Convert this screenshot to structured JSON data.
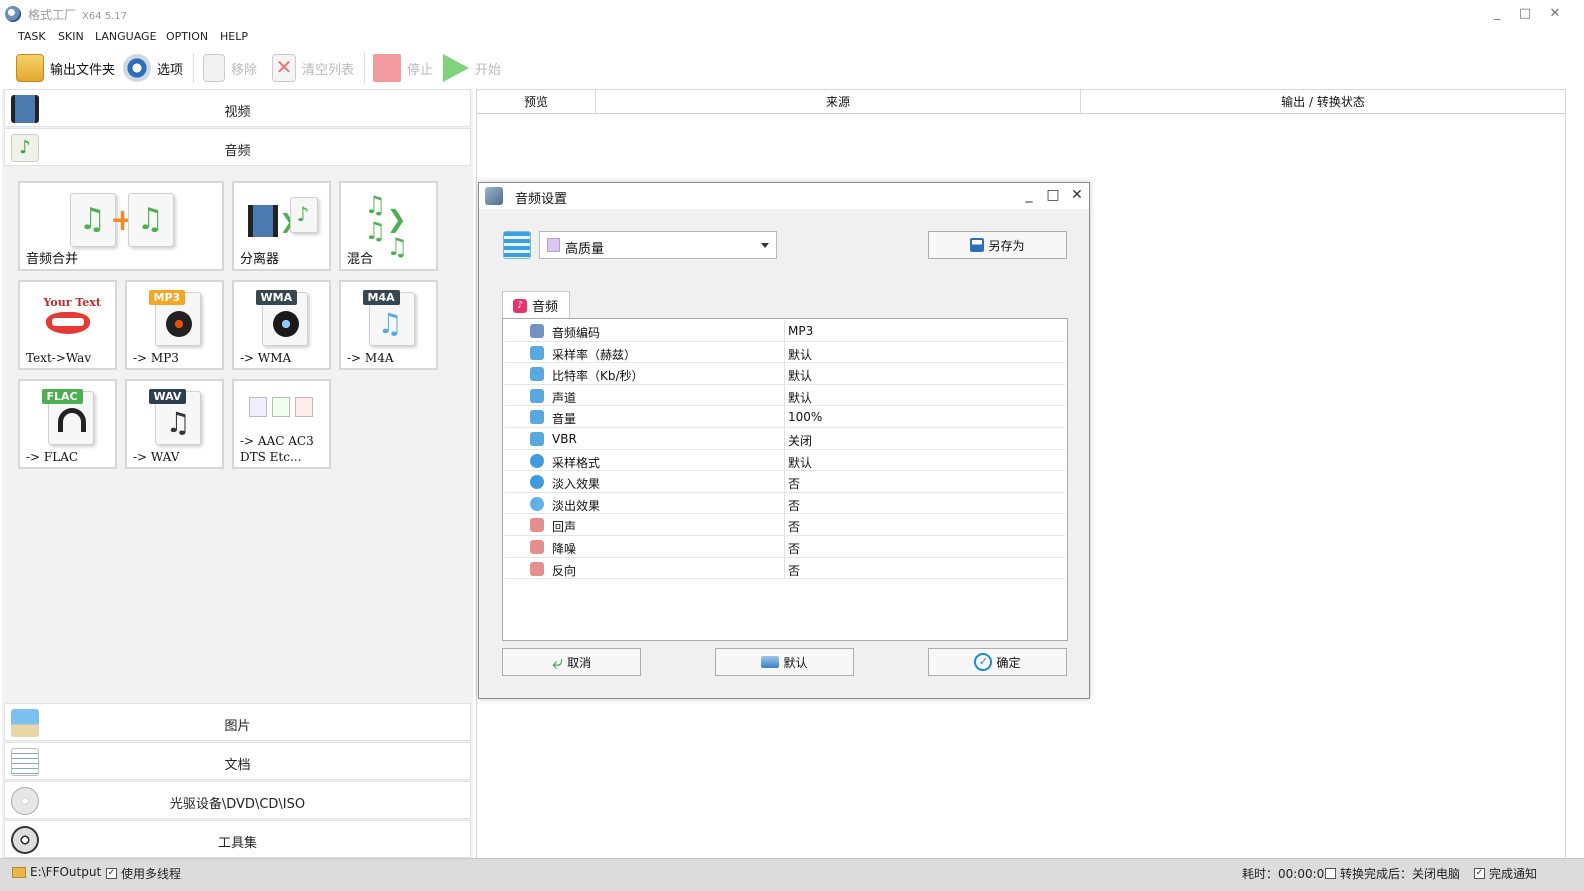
{
  "window": {
    "title": "格式工厂",
    "version": "X64 5.17"
  },
  "menu": [
    "TASK",
    "SKIN",
    "LANGUAGE",
    "OPTION",
    "HELP"
  ],
  "toolbar": {
    "output_folder": "输出文件夹",
    "options": "选项",
    "remove": "移除",
    "clear_list": "清空列表",
    "stop": "停止",
    "start": "开始"
  },
  "categories": {
    "video": "视频",
    "audio": "音频",
    "picture": "图片",
    "document": "文档",
    "rom": "光驱设备\\DVD\\CD\\ISO",
    "toolbox": "工具集"
  },
  "audio_tools": {
    "merge": "音频合并",
    "splitter": "分离器",
    "mix": "混合",
    "text_wav": "Text->Wav",
    "mp3": "-> MP3",
    "wma": "-> WMA",
    "m4a": "-> M4A",
    "flac": "-> FLAC",
    "wav": "-> WAV",
    "others_line1": "-> AAC AC3",
    "others_line2": "DTS Etc...",
    "text_art": "Your Text",
    "badges": {
      "mp3": "MP3",
      "wma": "WMA",
      "m4a": "M4A",
      "flac": "FLAC",
      "wav": "WAV"
    }
  },
  "file_list": {
    "columns": [
      "预览",
      "来源",
      "输出 / 转换状态"
    ]
  },
  "dialog": {
    "title": "音频设置",
    "preset": "高质量",
    "save_as": "另存为",
    "tab": "音频",
    "properties": [
      {
        "name": "音频编码",
        "value": "MP3",
        "icon": "codec-icon",
        "color": "#5a7fb5"
      },
      {
        "name": "采样率（赫兹）",
        "value": "默认",
        "icon": "samplerate-icon",
        "color": "#3a9ad9"
      },
      {
        "name": "比特率（Kb/秒）",
        "value": "默认",
        "icon": "bitrate-icon",
        "color": "#3a9ad9"
      },
      {
        "name": "声道",
        "value": "默认",
        "icon": "channel-icon",
        "color": "#3a9ad9"
      },
      {
        "name": "音量",
        "value": "100%",
        "icon": "volume-icon",
        "color": "#3a9ad9"
      },
      {
        "name": "VBR",
        "value": "关闭",
        "icon": "vbr-icon",
        "color": "#3a9ad9"
      },
      {
        "name": "采样格式",
        "value": "默认",
        "icon": "sample-format-icon",
        "color": "#1e88d8"
      },
      {
        "name": "淡入效果",
        "value": "否",
        "icon": "fade-in-icon",
        "color": "#1e88d8"
      },
      {
        "name": "淡出效果",
        "value": "否",
        "icon": "fade-out-icon",
        "color": "#44a3e6"
      },
      {
        "name": "回声",
        "value": "否",
        "icon": "echo-icon",
        "color": "#e07a7a"
      },
      {
        "name": "降噪",
        "value": "否",
        "icon": "denoise-icon",
        "color": "#e07a7a"
      },
      {
        "name": "反向",
        "value": "否",
        "icon": "reverse-icon",
        "color": "#e07a7a"
      }
    ],
    "cancel": "取消",
    "default": "默认",
    "ok": "确定"
  },
  "status": {
    "output_path": "E:\\FFOutput",
    "multithread": "使用多线程",
    "elapsed": "耗时：00:00:00",
    "after_convert": "转换完成后：关闭电脑",
    "notify": "完成通知",
    "multithread_checked": true,
    "after_convert_checked": false,
    "notify_checked": true
  }
}
